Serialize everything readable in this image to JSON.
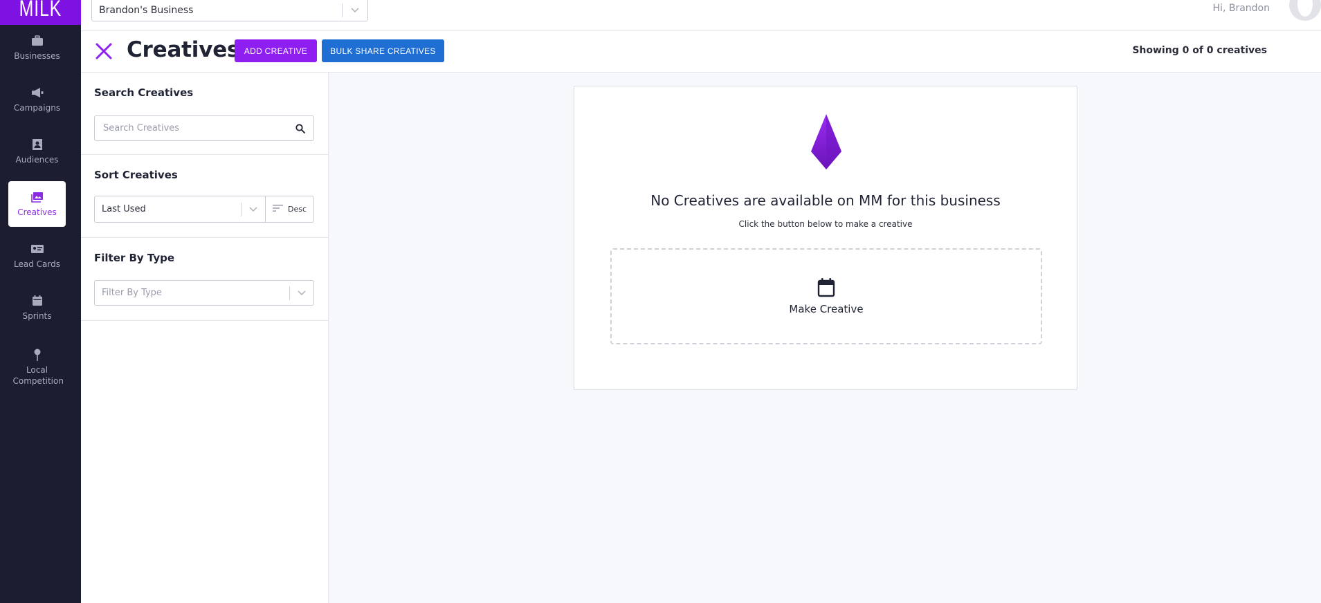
{
  "app": {
    "logo": "MILK"
  },
  "sidebar": {
    "items": [
      {
        "id": "businesses",
        "label": "Businesses",
        "icon": "briefcase-icon",
        "active": false
      },
      {
        "id": "campaigns",
        "label": "Campaigns",
        "icon": "megaphone-icon",
        "active": false
      },
      {
        "id": "audiences",
        "label": "Audiences",
        "icon": "contact-book-icon",
        "active": false
      },
      {
        "id": "creatives",
        "label": "Creatives",
        "icon": "image-gallery-icon",
        "active": true
      },
      {
        "id": "lead-cards",
        "label": "Lead Cards",
        "icon": "id-card-icon",
        "active": false
      },
      {
        "id": "sprints",
        "label": "Sprints",
        "icon": "calendar-icon",
        "active": false
      },
      {
        "id": "local-competition",
        "label": "Local Competition",
        "icon": "map-pin-icon",
        "active": false
      }
    ]
  },
  "header": {
    "business_select": "Brandon's Business",
    "greeting": "Hi, Brandon"
  },
  "titlebar": {
    "title": "Creatives",
    "add_label": "ADD CREATIVE",
    "bulk_label": "BULK SHARE CREATIVES",
    "showing": "Showing 0 of 0 creatives"
  },
  "filters": {
    "search": {
      "heading": "Search Creatives",
      "placeholder": "Search Creatives"
    },
    "sort": {
      "heading": "Sort Creatives",
      "value": "Last Used",
      "direction": "Desc"
    },
    "type": {
      "heading": "Filter By Type",
      "placeholder": "Filter By Type"
    }
  },
  "empty_state": {
    "title": "No Creatives are available on MM for this business",
    "subtitle": "Click the button below to make a creative",
    "make_label": "Make Creative"
  },
  "colors": {
    "sidebar_bg": "#1c1d31",
    "brand_purple": "#8e1ff0",
    "bulk_blue": "#1f6ed4",
    "active_text": "#8a2be2"
  }
}
